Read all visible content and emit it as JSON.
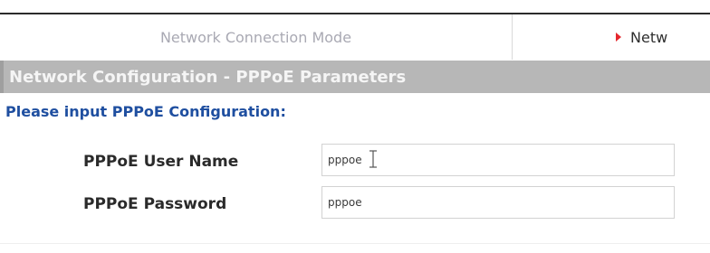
{
  "tabs": {
    "inactive_label": "Network Connection Mode",
    "active_label": "Netw"
  },
  "section_header": {
    "title": "Network Configuration - PPPoE Parameters"
  },
  "prompt": {
    "text": "Please input PPPoE Configuration:"
  },
  "form": {
    "user_name": {
      "label": "PPPoE User Name",
      "value": "pppoe"
    },
    "password": {
      "label": "PPPoE Password",
      "value": "pppoe"
    }
  },
  "colors": {
    "accent_arrow": "#e5272d",
    "header_bg": "#b7b7b7",
    "prompt_text": "#1f4fa0"
  },
  "icons": {
    "tab_marker": "right-triangle-icon",
    "cursor": "text-cursor-icon"
  }
}
